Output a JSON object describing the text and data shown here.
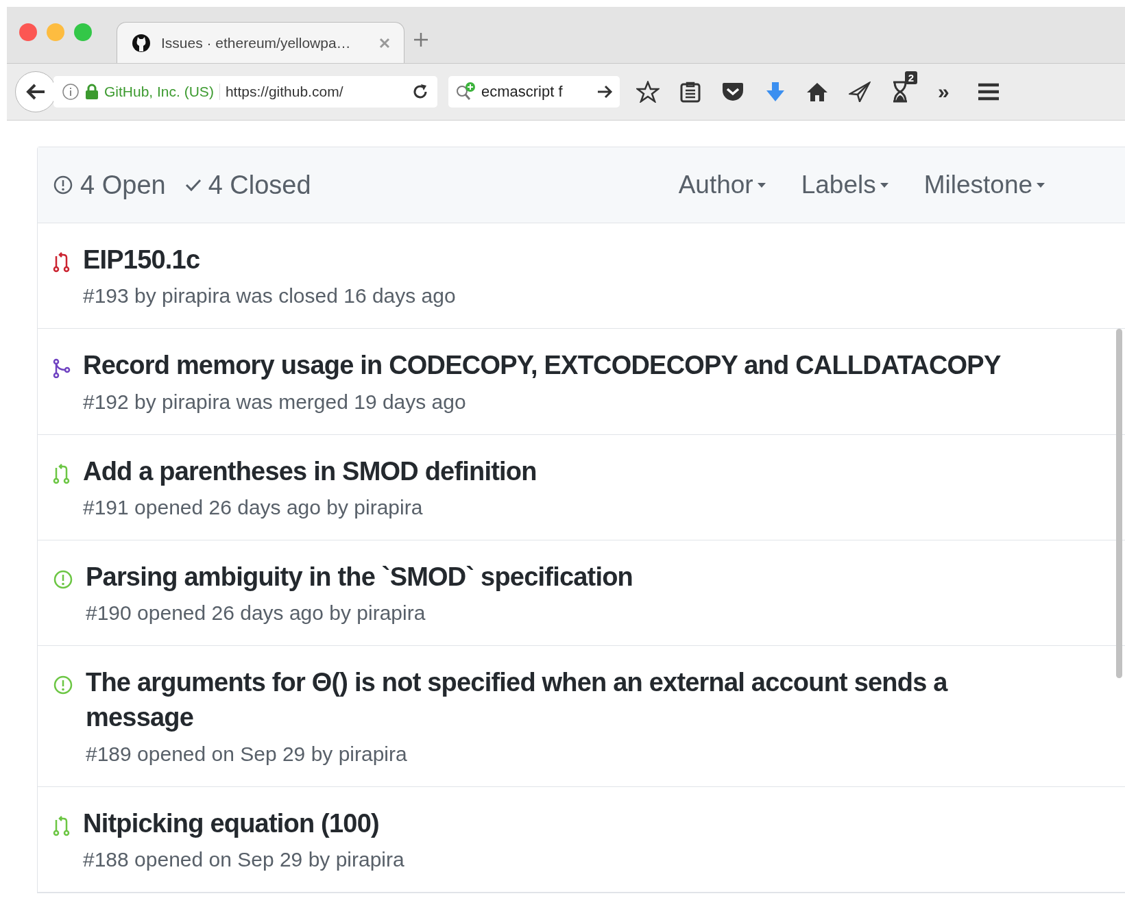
{
  "browser": {
    "tab": {
      "title": "Issues · ethereum/yellowpa…",
      "selected": true
    },
    "identity": "GitHub, Inc. (US)",
    "url": "https://github.com/",
    "search": "ecmascript f",
    "badge": "2",
    "overflow": "»"
  },
  "filters": {
    "open": "4 Open",
    "closed": "4 Closed",
    "menus": [
      "Author",
      "Labels",
      "Milestone"
    ]
  },
  "issues": [
    {
      "kind": "pr-closed",
      "title": "EIP150.1c",
      "meta": "#193 by pirapira was closed 16 days ago"
    },
    {
      "kind": "pr-merged",
      "title": "Record memory usage in CODECOPY, EXTCODECOPY and CALLDATACOPY",
      "meta": "#192 by pirapira was merged 19 days ago"
    },
    {
      "kind": "pr-open",
      "title": "Add a parentheses in SMOD definition",
      "meta": "#191 opened 26 days ago by pirapira"
    },
    {
      "kind": "issue-open",
      "title": "Parsing ambiguity in the `SMOD` specification",
      "meta": "#190 opened 26 days ago by pirapira"
    },
    {
      "kind": "issue-open",
      "title": "The arguments for Θ() is not specified when an external account sends a message",
      "meta": "#189 opened on Sep 29 by pirapira"
    },
    {
      "kind": "pr-open",
      "title": "Nitpicking equation (100)",
      "meta": "#188 opened on Sep 29 by pirapira"
    }
  ]
}
